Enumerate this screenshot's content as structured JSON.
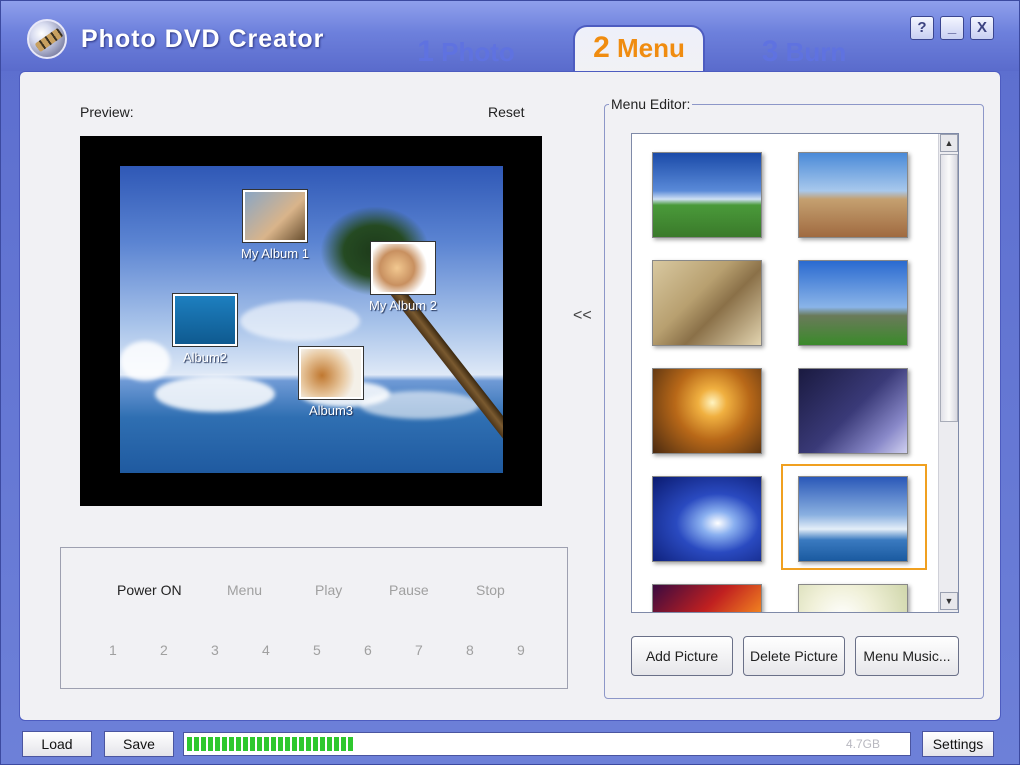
{
  "app": {
    "title": "Photo DVD Creator"
  },
  "tabs": [
    {
      "num": "1",
      "label": "Photo"
    },
    {
      "num": "2",
      "label": "Menu"
    },
    {
      "num": "3",
      "label": "Burn"
    }
  ],
  "window_controls": {
    "help": "?",
    "minimize": "_",
    "close": "X"
  },
  "preview": {
    "label": "Preview:",
    "reset": "Reset",
    "albums": [
      {
        "caption": "My Album 1",
        "icon": "friends-photo-icon"
      },
      {
        "caption": "My Album 2",
        "icon": "family-photo-icon"
      },
      {
        "caption": "Album2",
        "icon": "diver-photo-icon"
      },
      {
        "caption": "Album3",
        "icon": "puppies-photo-icon"
      }
    ]
  },
  "nav": {
    "collapse": "<<"
  },
  "remote": {
    "buttons": [
      "Power ON",
      "Menu",
      "Play",
      "Pause",
      "Stop"
    ],
    "numbers": [
      "1",
      "2",
      "3",
      "4",
      "5",
      "6",
      "7",
      "8",
      "9"
    ]
  },
  "menu_editor": {
    "label": "Menu Editor:",
    "thumbnails": [
      {
        "name": "sky-field"
      },
      {
        "name": "wheat-field"
      },
      {
        "name": "sand-dune"
      },
      {
        "name": "stonehenge"
      },
      {
        "name": "sunset"
      },
      {
        "name": "lightning"
      },
      {
        "name": "blue-light"
      },
      {
        "name": "palm-beach"
      },
      {
        "name": "fire-abstract"
      },
      {
        "name": "white-roses"
      }
    ],
    "selected": "palm-beach",
    "buttons": {
      "add": "Add Picture",
      "delete": "Delete Picture",
      "music": "Menu Music..."
    }
  },
  "bottom": {
    "load": "Load",
    "save": "Save",
    "capacity": "4.7GB",
    "progress": 0.23,
    "settings": "Settings"
  },
  "colors": {
    "accent": "#f08c10",
    "tab_inactive": "#5f72e0",
    "frame": "#5d6fcf",
    "progress": "#2ec82e"
  }
}
